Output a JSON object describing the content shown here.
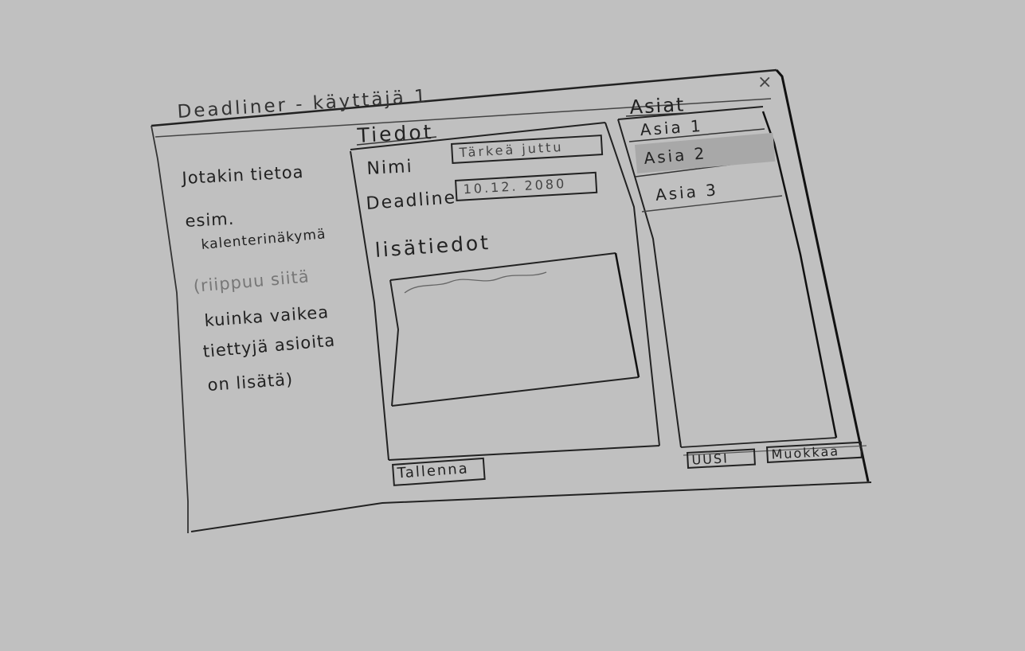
{
  "window": {
    "title": "Deadliner - käyttäjä 1",
    "close_glyph": "×"
  },
  "sidebar": {
    "lines": [
      "Jotakin tietoa",
      "esim.",
      "kalenterinäkymä",
      "(riippuu siitä",
      "kuinka vaikea",
      "tiettyjä asioita",
      "on lisätä)"
    ]
  },
  "details": {
    "title": "Tiedot",
    "name_label": "Nimi",
    "name_value": "Tärkeä juttu",
    "deadline_label": "Deadline",
    "deadline_value": "10.12. 2080",
    "extra_label": "lisätiedot",
    "save_label": "Tallenna"
  },
  "list": {
    "title": "Asiat",
    "items": [
      "Asia 1",
      "Asia 2",
      "Asia 3"
    ],
    "selected_index": 1,
    "new_label": "UUSI",
    "edit_label": "Muokkaa"
  },
  "colors": {
    "background": "#c0c0c0",
    "ink": "#222222",
    "selection": "#a8a8a8"
  }
}
